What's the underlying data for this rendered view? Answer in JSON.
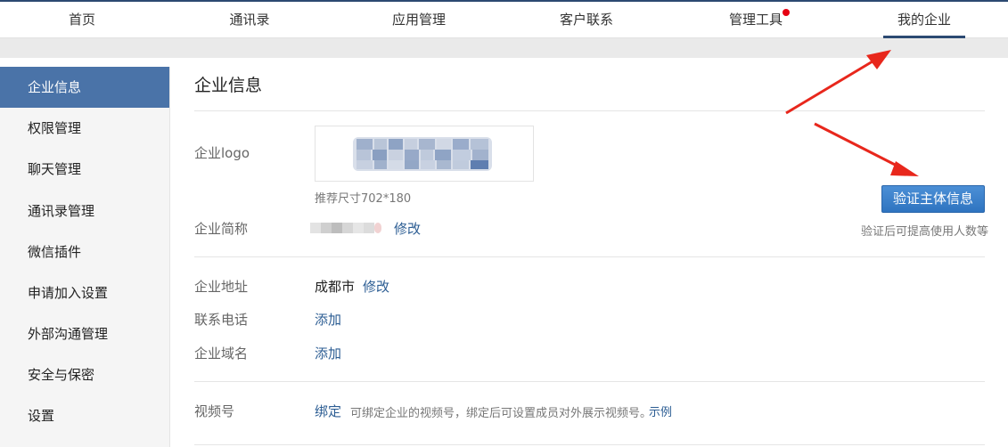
{
  "nav": {
    "items": [
      {
        "label": "首页"
      },
      {
        "label": "通讯录"
      },
      {
        "label": "应用管理"
      },
      {
        "label": "客户联系"
      },
      {
        "label": "管理工具"
      },
      {
        "label": "我的企业"
      }
    ],
    "active_index": 5,
    "badge_on_index": 4
  },
  "sidebar": {
    "items": [
      {
        "label": "企业信息"
      },
      {
        "label": "权限管理"
      },
      {
        "label": "聊天管理"
      },
      {
        "label": "通讯录管理"
      },
      {
        "label": "微信插件"
      },
      {
        "label": "申请加入设置"
      },
      {
        "label": "外部沟通管理"
      },
      {
        "label": "安全与保密"
      },
      {
        "label": "设置"
      }
    ],
    "active_index": 0
  },
  "main": {
    "title": "企业信息",
    "logo_label": "企业logo",
    "logo_hint": "推荐尺寸702*180",
    "name_label": "企业简称",
    "name_edit": "修改",
    "verify_button": "验证主体信息",
    "verify_hint": "验证后可提高使用人数等",
    "address_label": "企业地址",
    "address_value": "成都市",
    "address_edit": "修改",
    "phone_label": "联系电话",
    "phone_add": "添加",
    "domain_label": "企业域名",
    "domain_add": "添加",
    "channel_label": "视频号",
    "channel_bind": "绑定",
    "channel_desc": "可绑定企业的视频号，绑定后可设置成员对外展示视频号。",
    "channel_example": "示例"
  },
  "colors": {
    "accent": "#4a73a8",
    "link": "#2c5d93",
    "button": "#2f74c0",
    "arrow": "#e8271c",
    "badge": "#e60012"
  }
}
